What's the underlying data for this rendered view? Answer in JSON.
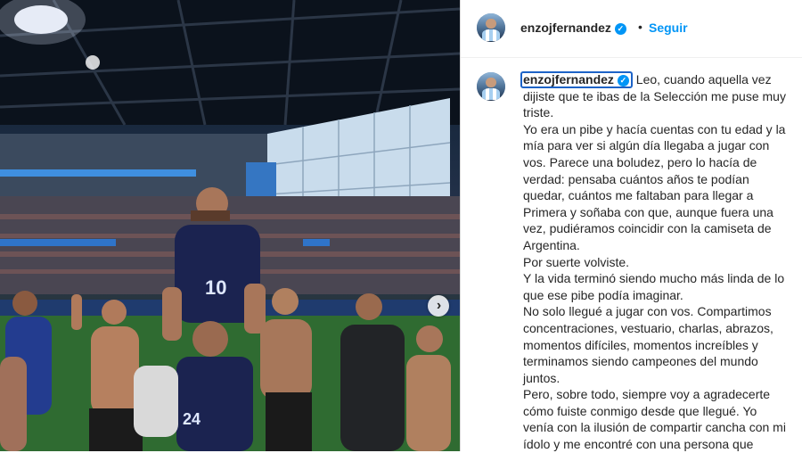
{
  "post": {
    "image_alt": "",
    "next_icon": "chevron-right-icon"
  },
  "header": {
    "username": "enzojfernandez",
    "verified_icon": "verified-badge-icon",
    "separator": "•",
    "follow_label": "Seguir"
  },
  "caption": {
    "username": "enzojfernandez",
    "lines": [
      "Leo, cuando aquella vez",
      "dijiste que te ibas de la Selección me puse muy",
      "triste.",
      "Yo era un pibe y hacía cuentas con tu edad y la",
      "mía para ver si algún día llegaba a jugar con",
      "vos. Parece una boludez, pero lo hacía de",
      "verdad: pensaba cuántos años te podían",
      "quedar, cuántos me faltaban para llegar a",
      "Primera y soñaba con que, aunque fuera una",
      "vez, pudiéramos coincidir con la camiseta de",
      "Argentina.",
      "Por suerte volviste.",
      "Y la vida terminó siendo mucho más linda de lo",
      "que ese pibe podía imaginar.",
      "No solo llegué a jugar con vos. Compartimos",
      "concentraciones, vestuario, charlas, abrazos,",
      "momentos difíciles, momentos increíbles y",
      "terminamos siendo campeones del mundo",
      "juntos.",
      "Pero, sobre todo, siempre voy a agradecerte",
      "cómo fuiste conmigo desde que llegué. Yo",
      "venía con la ilusión de compartir cancha con mi",
      "ídolo y me encontré con una persona que"
    ]
  },
  "colors": {
    "accent": "#0095f6",
    "text": "#262626",
    "focus": "#1d63c7"
  }
}
